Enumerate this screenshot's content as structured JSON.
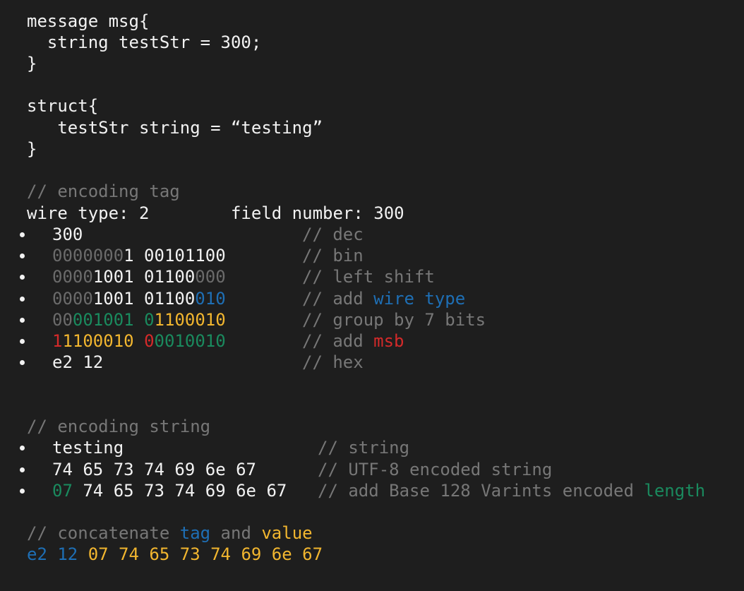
{
  "colors": {
    "background": "#1e1e1e",
    "text": "#f2f2f2",
    "dim": "#6b6b6b",
    "comment": "#777777",
    "blue": "#1e6fb5",
    "green": "#1a8a5e",
    "yellow": "#f2b62f",
    "red": "#d42a2a"
  },
  "code_block": {
    "message_decl": "message msg{",
    "message_field": "  string testStr = 300;",
    "message_close": "}",
    "struct_decl": "struct{",
    "struct_field": "   testStr string = “testing”",
    "struct_close": "}"
  },
  "tag_section": {
    "comment": "// encoding tag",
    "header": "wire type: 2        field number: 300",
    "rows": [
      {
        "value_parts": [
          "300"
        ],
        "comment_parts": [
          "// dec"
        ]
      },
      {
        "value_parts": [
          "0000000",
          "1 00101100"
        ],
        "comment_parts": [
          "// bin"
        ]
      },
      {
        "value_parts": [
          "0000",
          "1001 01100",
          "000"
        ],
        "comment_parts": [
          "// left shift"
        ]
      },
      {
        "value_parts": [
          "0000",
          "1001 01100",
          "010"
        ],
        "comment_parts": [
          "// add ",
          "wire",
          " ",
          "type"
        ]
      },
      {
        "value_parts": [
          "00",
          "001001",
          " ",
          "0",
          "1100010"
        ],
        "comment_parts": [
          "// group by 7 bits"
        ]
      },
      {
        "value_parts": [
          "1",
          "1100010",
          " ",
          "0",
          "0010010"
        ],
        "comment_parts": [
          "// add ",
          "msb"
        ]
      },
      {
        "value_parts": [
          "e2 12"
        ],
        "comment_parts": [
          "// hex"
        ]
      }
    ]
  },
  "string_section": {
    "comment": "// encoding string",
    "rows": [
      {
        "value_parts": [
          "testing"
        ],
        "comment_parts": [
          "// string"
        ]
      },
      {
        "value_parts": [
          "74 65 73 74 69 6e 67"
        ],
        "comment_parts": [
          "// UTF-8 encoded string"
        ]
      },
      {
        "value_parts": [
          "07",
          " 74 65 73 74 69 6e 67"
        ],
        "comment_parts": [
          "// add Base 128 Varints encoded ",
          "length"
        ]
      }
    ]
  },
  "concat_section": {
    "comment_parts": [
      "// concatenate ",
      "tag",
      " and ",
      "value"
    ],
    "result_parts": [
      "e2 12",
      " 07 74 65 73 74 69 6e 67"
    ]
  }
}
